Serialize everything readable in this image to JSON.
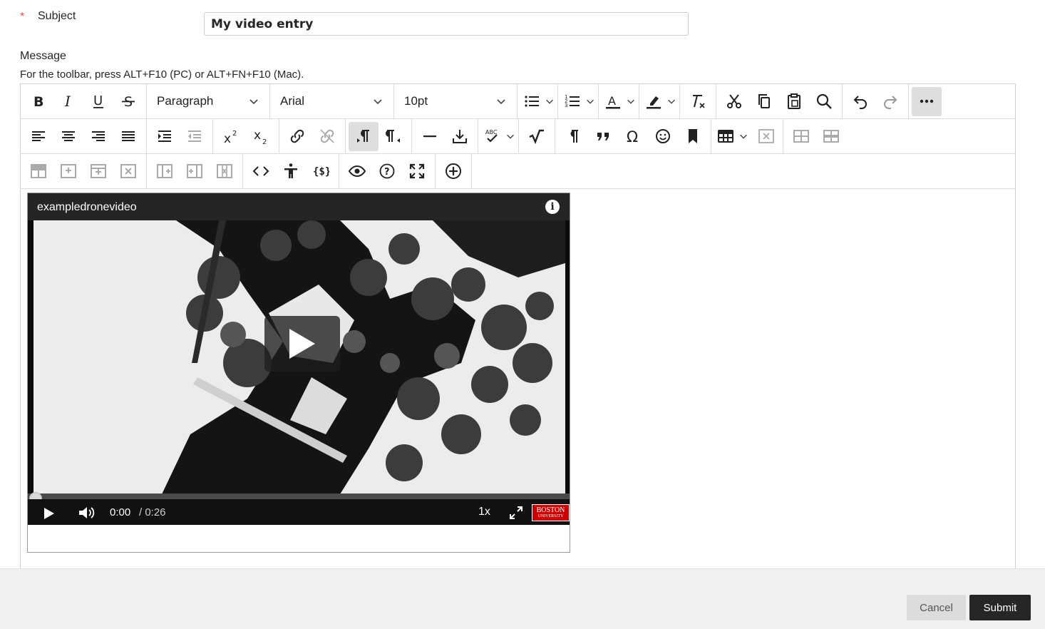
{
  "form": {
    "required_mark": "*",
    "subject_label": "Subject",
    "subject_value": "My video entry",
    "message_label": "Message",
    "toolbar_hint": "For the toolbar, press ALT+F10 (PC) or ALT+FN+F10 (Mac)."
  },
  "toolbar": {
    "block_format": "Paragraph",
    "font_family": "Arial",
    "font_size": "10pt"
  },
  "video": {
    "title": "exampledronevideo",
    "info_symbol": "i",
    "current_time": "0:00",
    "duration": "/ 0:26",
    "playback_speed": "1x",
    "progress_fraction": 0,
    "logo_line1": "BOSTON",
    "logo_line2": "UNIVERSITY",
    "logo_color": "#cc0000"
  },
  "footer": {
    "cancel_label": "Cancel",
    "submit_label": "Submit"
  }
}
